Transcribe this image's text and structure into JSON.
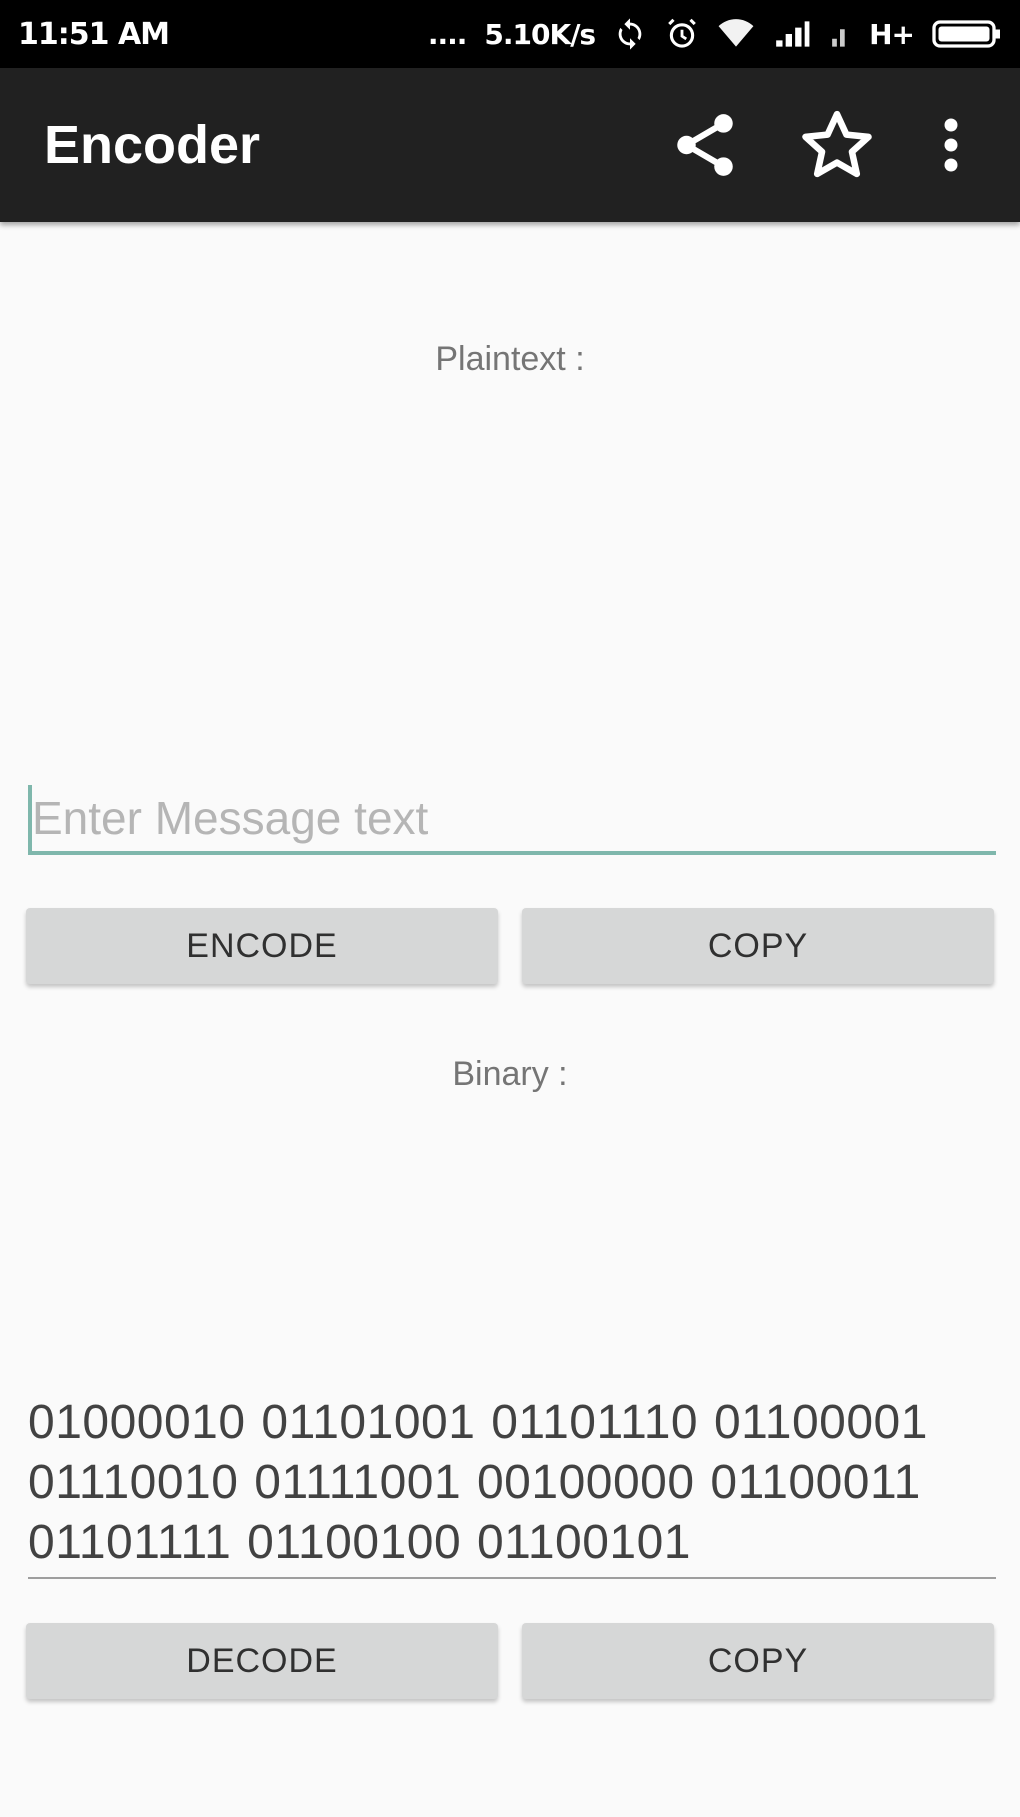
{
  "status_bar": {
    "time": "11:51 AM",
    "dots": "....",
    "network_speed": "5.10K/s",
    "icons": [
      "sync-icon",
      "alarm-icon",
      "wifi-icon",
      "signal-icon",
      "signal-icon-secondary",
      "hplus-icon",
      "battery-icon"
    ],
    "hplus_label": "H+"
  },
  "toolbar": {
    "title": "Encoder",
    "icons": [
      "share-icon",
      "star-icon",
      "overflow-menu-icon"
    ]
  },
  "plaintext": {
    "label": "Plaintext :",
    "input_value": "",
    "input_placeholder": "Enter Message text",
    "encode_label": "ENCODE",
    "copy_label": "COPY"
  },
  "binary": {
    "label": "Binary :",
    "output_value": "01000010 01101001 01101110 01100001 01110010 01111001 00100000 01100011 01101111 01100100 01100101",
    "decode_label": "DECODE",
    "copy_label": "COPY"
  },
  "colors": {
    "toolbar": "#212121",
    "status_bar": "#000000",
    "accent": "#7fb7ac",
    "button": "#d6d7d7",
    "background": "#fafafa"
  }
}
